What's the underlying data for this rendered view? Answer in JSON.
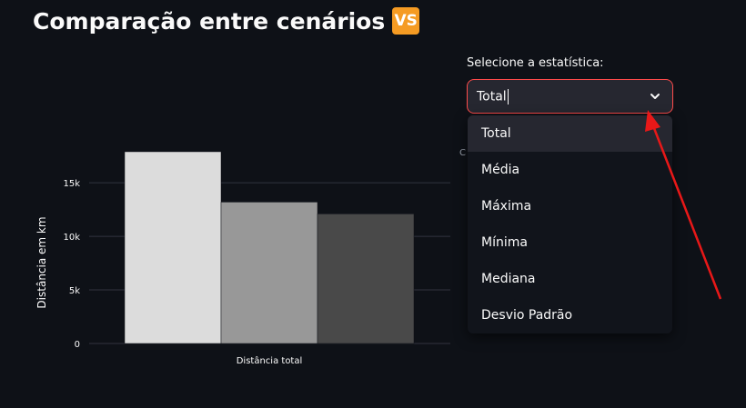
{
  "title": "Comparação entre cenários",
  "title_badge": "VS",
  "select": {
    "label": "Selecione a estatística:",
    "value": "Total",
    "options": [
      "Total",
      "Média",
      "Máxima",
      "Mínima",
      "Mediana",
      "Desvio Padrão"
    ],
    "selected_index": 0
  },
  "partial_text": "C",
  "colors": {
    "background": "#0e1117",
    "accent_border": "#ff4b4b",
    "badge": "#f59b23",
    "annotation_arrow": "#e81818"
  },
  "chart_data": {
    "type": "bar",
    "categories": [
      "Distância total"
    ],
    "series": [
      {
        "values": [
          17900
        ],
        "color": "#dcdcdc"
      },
      {
        "values": [
          13200
        ],
        "color": "#989898"
      },
      {
        "values": [
          12100
        ],
        "color": "#494949"
      }
    ],
    "xlabel": "Distância total",
    "ylabel": "Distância em km",
    "ylim": [
      0,
      19000
    ],
    "yticks": [
      0,
      5000,
      10000,
      15000
    ],
    "ytick_labels": [
      "0",
      "5k",
      "10k",
      "15k"
    ],
    "grid": true
  }
}
